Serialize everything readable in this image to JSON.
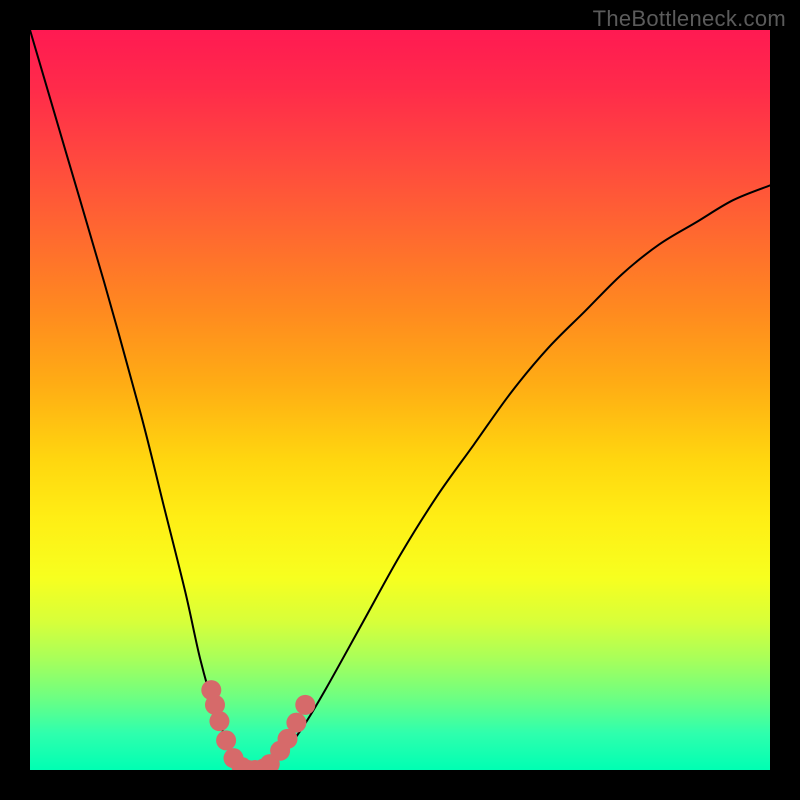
{
  "watermark": "TheBottleneck.com",
  "chart_data": {
    "type": "line",
    "title": "",
    "xlabel": "",
    "ylabel": "",
    "xlim": [
      0,
      100
    ],
    "ylim": [
      0,
      100
    ],
    "series": [
      {
        "name": "bottleneck-curve",
        "x": [
          0,
          5,
          10,
          15,
          18,
          21,
          23,
          25,
          27,
          28,
          29,
          30,
          31,
          34,
          37,
          40,
          45,
          50,
          55,
          60,
          65,
          70,
          75,
          80,
          85,
          90,
          95,
          100
        ],
        "values": [
          100,
          83,
          66,
          48,
          36,
          24,
          15,
          8,
          3,
          1,
          0,
          0,
          0,
          2,
          6,
          11,
          20,
          29,
          37,
          44,
          51,
          57,
          62,
          67,
          71,
          74,
          77,
          79
        ]
      }
    ],
    "markers": {
      "name": "highlight-dots",
      "x": [
        24.5,
        25.0,
        25.6,
        26.5,
        27.5,
        28.6,
        29.5,
        30.4,
        31.6,
        32.4,
        33.8,
        34.8,
        36.0,
        37.2
      ],
      "y": [
        10.8,
        8.8,
        6.6,
        4.0,
        1.6,
        0.4,
        0.0,
        0.0,
        0.2,
        0.8,
        2.6,
        4.2,
        6.4,
        8.8
      ],
      "color": "#d66a6a",
      "radius_px": 10
    },
    "gradient_stops": [
      {
        "pos": 0.0,
        "color": "#ff1a52"
      },
      {
        "pos": 0.5,
        "color": "#ffd60f"
      },
      {
        "pos": 0.75,
        "color": "#f7ff1f"
      },
      {
        "pos": 1.0,
        "color": "#00ffb3"
      }
    ]
  }
}
